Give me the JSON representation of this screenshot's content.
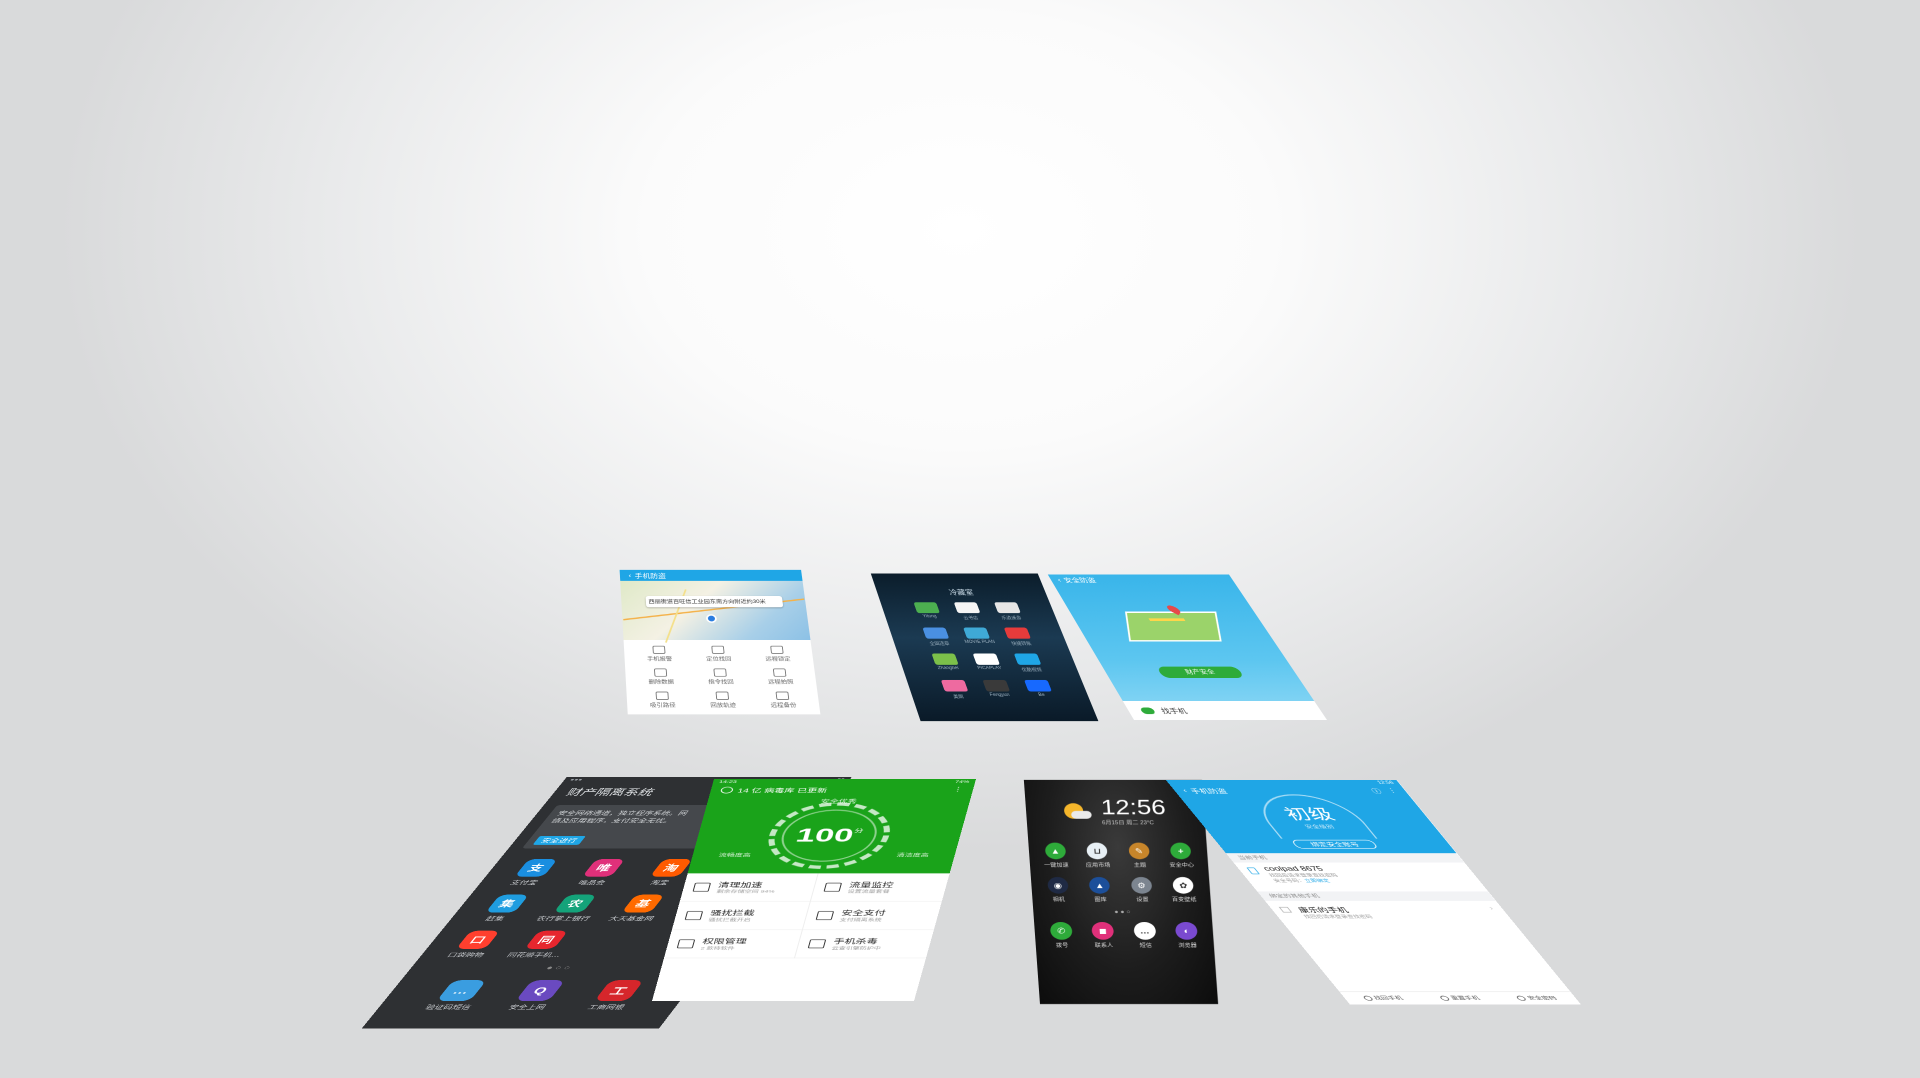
{
  "colors": {
    "green": "#1aa31a",
    "blue": "#1fa6e6",
    "dark": "#2e3033",
    "black": "#141414"
  },
  "finance": {
    "title": "财产隔离系统",
    "exit_label": "退出",
    "notice": "安全网络通道，独立程序系统。网络及应用程序，支付安全无忧。",
    "safe_btn": "安全进行",
    "apps": [
      {
        "label": "支付宝",
        "icon": "alipay-icon",
        "color": "#1a8ee0",
        "glyph": "支"
      },
      {
        "label": "唯品会",
        "icon": "vip-icon",
        "color": "#e0307a",
        "glyph": "唯"
      },
      {
        "label": "淘宝",
        "icon": "taobao-icon",
        "color": "#ff5a00",
        "glyph": "淘"
      },
      {
        "label": "炒币",
        "icon": "coin-icon",
        "color": "#e6262e",
        "glyph": "币"
      },
      {
        "label": "赶集",
        "icon": "ganji-icon",
        "color": "#1f9de0",
        "glyph": "集"
      },
      {
        "label": "农行掌上银行",
        "icon": "abc-bank-icon",
        "color": "#14a37a",
        "glyph": "农"
      },
      {
        "label": "大天基金网",
        "icon": "fund-icon",
        "color": "#ff6a00",
        "glyph": "基"
      },
      {
        "label": "招商银行",
        "icon": "cmb-icon",
        "color": "#d6262b",
        "glyph": "招"
      },
      {
        "label": "口袋购物",
        "icon": "pocket-icon",
        "color": "#ff3f2e",
        "glyph": "口"
      },
      {
        "label": "同花顺手机…",
        "icon": "ths-icon",
        "color": "#e6262e",
        "glyph": "同"
      }
    ],
    "dock": [
      {
        "label": "验证码短信",
        "icon": "sms-verify-icon",
        "color": "#3a9de0",
        "glyph": "…"
      },
      {
        "label": "安全上网",
        "icon": "secure-browse-icon",
        "color": "#6a4ac0",
        "glyph": "Q"
      },
      {
        "label": "工商网银",
        "icon": "icbc-icon",
        "color": "#d6262b",
        "glyph": "工"
      }
    ]
  },
  "security": {
    "status_left": "14:23",
    "status_right": "74%",
    "banner": "14 亿 病毒库 已更新",
    "score": "100",
    "score_unit": "分",
    "safe_text": "安全优秀",
    "left_caption": "流畅度高",
    "right_caption": "清洁度高",
    "items": [
      {
        "title": "清理加速",
        "sub": "剩余存储空间 94%",
        "icon": "trash-icon"
      },
      {
        "title": "流量监控",
        "sub": "设置流量套餐",
        "icon": "bars-icon"
      },
      {
        "title": "骚扰拦截",
        "sub": "骚扰拦截开启",
        "icon": "block-icon"
      },
      {
        "title": "安全支付",
        "sub": "支付隔离系统",
        "icon": "shield-yen-icon"
      },
      {
        "title": "权限管理",
        "sub": "2 款待软件",
        "icon": "grid-icon"
      },
      {
        "title": "手机杀毒",
        "sub": "云查引擎防护中",
        "icon": "shield-bolt-icon"
      }
    ]
  },
  "home": {
    "time": "12:56",
    "date": "6月15日 周二 23°C",
    "apps": [
      {
        "label": "一键加速",
        "icon": "boost-icon",
        "color": "#2eab3a",
        "glyph": "▲"
      },
      {
        "label": "应用市场",
        "icon": "store-icon",
        "color": "#e8f0f5",
        "glyph": "⊔"
      },
      {
        "label": "主题",
        "icon": "theme-icon",
        "color": "#c7852a",
        "glyph": "✎"
      },
      {
        "label": "安全中心",
        "icon": "security-center-icon",
        "color": "#2eab3a",
        "glyph": "+"
      },
      {
        "label": "相机",
        "icon": "camera-icon",
        "color": "#1f2a44",
        "glyph": "◉"
      },
      {
        "label": "图库",
        "icon": "gallery-icon",
        "color": "#1c4f9a",
        "glyph": "▲"
      },
      {
        "label": "设置",
        "icon": "settings-icon",
        "color": "#7c8590",
        "glyph": "⚙"
      },
      {
        "label": "百变壁纸",
        "icon": "wallpaper-icon",
        "color": "#ffffff",
        "glyph": "✿"
      }
    ],
    "dock": [
      {
        "label": "拨号",
        "icon": "phone-icon",
        "color": "#2eab3a",
        "glyph": "✆"
      },
      {
        "label": "联系人",
        "icon": "contacts-icon",
        "color": "#e0307a",
        "glyph": "◼"
      },
      {
        "label": "短信",
        "icon": "message-icon",
        "color": "#ffffff",
        "glyph": "…"
      },
      {
        "label": "浏览器",
        "icon": "browser-icon",
        "color": "#7a4ad0",
        "glyph": "◐"
      }
    ]
  },
  "findphone": {
    "status_right": "12:56",
    "title": "手机防盗",
    "level": "初级",
    "level_sub": "安全级别",
    "bind_btn": "绑定安全账号",
    "section1": "当前手机",
    "device_name": "coolpad 8675",
    "device_sub1": "找回后请求登录查找密码",
    "device_sub2": "安全号码：",
    "device_link": "立即绑定",
    "section2": "绑定的其他手机",
    "other_name": "康乐的手机",
    "other_sub": "找回后请求登录查找密码",
    "nav": [
      {
        "label": "找回手机",
        "icon": "location-icon"
      },
      {
        "label": "重置手机",
        "icon": "search-icon"
      },
      {
        "label": "安全密码",
        "icon": "keypad-icon"
      }
    ]
  },
  "map": {
    "title": "手机防盗",
    "pin_text": "西丽街道百旺信工业园东南方向附近约30米",
    "items": [
      "手机报警",
      "定位找回",
      "远程锁定",
      "删除数据",
      "指令找回",
      "远程拍照",
      "吸引路径",
      "回放轨迹",
      "远程备份"
    ]
  },
  "folder": {
    "title": "冷藏室",
    "apps": [
      {
        "label": "Yitong",
        "color": "#4caf50"
      },
      {
        "label": "云书店",
        "color": "#f5f5f5"
      },
      {
        "label": "乐逍遥游",
        "color": "#e6e6e6"
      },
      {
        "label": "全国违章",
        "color": "#4a90e2"
      },
      {
        "label": "MOVIE PLAN",
        "color": "#3fa9d6"
      },
      {
        "label": "快捷转账",
        "color": "#e63b3b"
      },
      {
        "label": "Zhangbei",
        "color": "#7cc04a"
      },
      {
        "label": "PICAPLAY",
        "color": "#ffffff"
      },
      {
        "label": "优酷视频",
        "color": "#1fa6e6"
      },
      {
        "label": "美图",
        "color": "#ee6aa0"
      },
      {
        "label": "Fengyun",
        "color": "#3a3a3a"
      },
      {
        "label": "Be",
        "color": "#1769ff"
      }
    ]
  },
  "locate": {
    "title": "安全防盗",
    "button": "财产安全",
    "bottom": "找手机"
  }
}
